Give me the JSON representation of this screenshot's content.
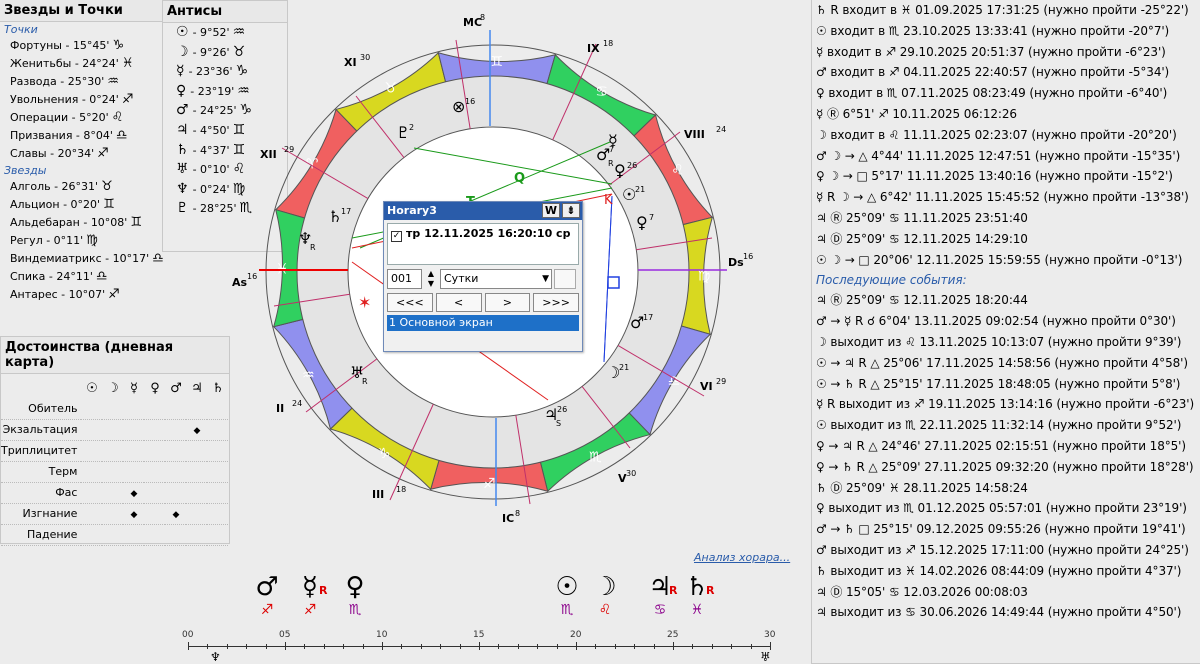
{
  "stars_panel": {
    "title": "Звезды и Точки",
    "points_header": "Точки",
    "points": [
      {
        "label": "Фортуны - 15°45'",
        "glyph": "♑"
      },
      {
        "label": "Женитьбы - 24°24'",
        "glyph": "♓"
      },
      {
        "label": "Развода - 25°30'",
        "glyph": "♒"
      },
      {
        "label": "Увольнения - 0°24'",
        "glyph": "♐"
      },
      {
        "label": "Операции - 5°20'",
        "glyph": "♌"
      },
      {
        "label": "Призвания - 8°04'",
        "glyph": "♎"
      },
      {
        "label": "Славы - 20°34'",
        "glyph": "♐"
      }
    ],
    "stars_header": "Звезды",
    "stars": [
      {
        "label": "Алголь - 26°31'",
        "glyph": "♉"
      },
      {
        "label": "Альцион - 0°20'",
        "glyph": "♊"
      },
      {
        "label": "Альдебаран - 10°08'",
        "glyph": "♊"
      },
      {
        "label": "Регул - 0°11'",
        "glyph": "♍"
      },
      {
        "label": "Виндемиатрикс - 10°17'",
        "glyph": "♎"
      },
      {
        "label": "Спика - 24°11'",
        "glyph": "♎"
      },
      {
        "label": "Антарес - 10°07'",
        "glyph": "♐"
      }
    ]
  },
  "antis_panel": {
    "title": "Антисы",
    "rows": [
      {
        "planet": "☉",
        "label": "- 9°52'",
        "sign": "♒"
      },
      {
        "planet": "☽",
        "label": "- 9°26'",
        "sign": "♉"
      },
      {
        "planet": "☿",
        "label": "- 23°36'",
        "sign": "♑"
      },
      {
        "planet": "♀",
        "label": "- 23°19'",
        "sign": "♒"
      },
      {
        "planet": "♂",
        "label": "- 24°25'",
        "sign": "♑"
      },
      {
        "planet": "♃",
        "label": "- 4°50'",
        "sign": "♊"
      },
      {
        "planet": "♄",
        "label": "- 4°37'",
        "sign": "♊"
      },
      {
        "planet": "♅",
        "label": "- 0°10'",
        "sign": "♌"
      },
      {
        "planet": "♆",
        "label": "- 0°24'",
        "sign": "♍"
      },
      {
        "planet": "♇",
        "label": "- 28°25'",
        "sign": "♏"
      }
    ]
  },
  "dignities": {
    "title": "Достоинства (дневная карта)",
    "planets": [
      "☉",
      "☽",
      "☿",
      "♀",
      "♂",
      "♃",
      "♄"
    ],
    "rows": [
      {
        "label": "Обитель",
        "marks": [
          0,
          0,
          0,
          0,
          0,
          0,
          0
        ]
      },
      {
        "label": "Экзальтация",
        "marks": [
          0,
          0,
          0,
          0,
          0,
          1,
          0
        ]
      },
      {
        "label": "Триплицитет",
        "marks": [
          0,
          0,
          0,
          0,
          0,
          0,
          0
        ]
      },
      {
        "label": "Терм",
        "marks": [
          0,
          0,
          0,
          0,
          0,
          0,
          0
        ]
      },
      {
        "label": "Фас",
        "marks": [
          0,
          0,
          1,
          0,
          0,
          0,
          0
        ]
      },
      {
        "label": "Изгнание",
        "marks": [
          0,
          0,
          1,
          0,
          1,
          0,
          0
        ]
      },
      {
        "label": "Падение",
        "marks": [
          0,
          0,
          0,
          0,
          0,
          0,
          0
        ]
      }
    ],
    "mark_symbol": "◆"
  },
  "events": {
    "list": [
      "♄ R входит в ♓ 01.09.2025 17:31:25 (нужно пройти -25°22')",
      "☉ входит в ♏ 23.10.2025 13:33:41 (нужно пройти -20°7')",
      "☿ входит в ♐ 29.10.2025 20:51:37 (нужно пройти -6°23')",
      "♂ входит в ♐ 04.11.2025 22:40:57 (нужно пройти -5°34')",
      "♀ входит в ♏ 07.11.2025 08:23:49 (нужно пройти -6°40')",
      "☿ Ⓡ 6°51' ♐ 10.11.2025 06:12:26",
      "☽ входит в ♌ 11.11.2025 02:23:07 (нужно пройти -20°20')",
      "♂ ☽ → △ 4°44' 11.11.2025 12:47:51 (нужно пройти -15°35')",
      "♀ ☽ → □ 5°17' 11.11.2025 13:40:16 (нужно пройти -15°2')",
      "☿ R ☽ → △ 6°42' 11.11.2025 15:45:52 (нужно пройти -13°38')",
      "♃ Ⓡ 25°09' ♋ 11.11.2025 23:51:40",
      "♃ Ⓓ 25°09' ♋ 12.11.2025 14:29:10",
      "☉ ☽ → □ 20°06' 12.11.2025 15:59:55 (нужно пройти -0°13')"
    ],
    "next_header": "Последующие события:",
    "next": [
      "♃ Ⓡ 25°09' ♋ 12.11.2025 18:20:44",
      "♂ → ☿ R ☌ 6°04' 13.11.2025 09:02:54 (нужно пройти 0°30')",
      "☽ выходит из ♌ 13.11.2025 10:13:07 (нужно пройти 9°39')",
      "☉ → ♃ R △ 25°06' 17.11.2025 14:58:56 (нужно пройти 4°58')",
      "☉ → ♄ R △ 25°15' 17.11.2025 18:48:05 (нужно пройти 5°8')",
      "☿ R выходит из ♐ 19.11.2025 13:14:16 (нужно пройти -6°23')",
      "☉ выходит из ♏ 22.11.2025 11:32:14 (нужно пройти 9°52')",
      "♀ → ♃ R △ 24°46' 27.11.2025 02:15:51 (нужно пройти 18°5')",
      "♀ → ♄ R △ 25°09' 27.11.2025 09:32:20 (нужно пройти 18°28')",
      "♄ Ⓓ 25°09' ♓ 28.11.2025 14:58:24",
      "♀ выходит из ♏ 01.12.2025 05:57:01 (нужно пройти 23°19')",
      "♂ → ♄ □ 25°15' 09.12.2025 09:55:26 (нужно пройти 19°41')",
      "♂ выходит из ♐ 15.12.2025 17:11:00 (нужно пройти 24°25')",
      "♄ выходит из ♓ 14.02.2026 08:44:09 (нужно пройти 4°37')",
      "♃ Ⓓ 15°05' ♋ 12.03.2026 00:08:03",
      "♃ выходит из ♋ 30.06.2026 14:49:44 (нужно пройти 4°50')"
    ]
  },
  "chart": {
    "angles": {
      "mc": "MC",
      "mc_deg": "8",
      "ic": "IC",
      "ic_deg": "8",
      "as": "As",
      "as_deg": "16",
      "ds": "Ds",
      "ds_deg": "16"
    },
    "houses": [
      {
        "num": "IX",
        "deg": "18"
      },
      {
        "num": "VIII",
        "deg": "24"
      },
      {
        "num": "VI",
        "deg": "29"
      },
      {
        "num": "V",
        "deg": "30"
      },
      {
        "num": "III",
        "deg": "18"
      },
      {
        "num": "II",
        "deg": "24"
      },
      {
        "num": "XII",
        "deg": "29"
      },
      {
        "num": "XI",
        "deg": "30"
      }
    ],
    "signs": [
      "♈",
      "♉",
      "♊",
      "♋",
      "♌",
      "♍",
      "♎",
      "♏",
      "♐",
      "♑",
      "♒",
      "♓"
    ],
    "sign_colors": [
      "#f06060",
      "#d8d820",
      "#9090ee",
      "#30d060",
      "#f06060",
      "#d8d820",
      "#9090ee",
      "#30d060",
      "#f06060",
      "#d8d820",
      "#9090ee",
      "#30d060"
    ],
    "planets": [
      {
        "glyph": "♂",
        "deg": "7",
        "note": "R"
      },
      {
        "glyph": "☿",
        "deg": "",
        "note": ""
      },
      {
        "glyph": "♀",
        "deg": "26",
        "note": ""
      },
      {
        "glyph": "☉",
        "deg": "21",
        "note": ""
      },
      {
        "glyph": "♀",
        "deg": "7",
        "note": ""
      },
      {
        "glyph": "♂",
        "deg": "17",
        "note": ""
      },
      {
        "glyph": "☽",
        "deg": "21",
        "note": ""
      },
      {
        "glyph": "♃",
        "deg": "26",
        "note": "S"
      },
      {
        "glyph": "♅",
        "deg": "",
        "note": "R"
      },
      {
        "glyph": "♆",
        "deg": "",
        "note": "R"
      },
      {
        "glyph": "♄",
        "deg": "17",
        "note": ""
      },
      {
        "glyph": "♇",
        "deg": "2",
        "note": ""
      },
      {
        "glyph": "⊗",
        "deg": "16",
        "note": ""
      }
    ],
    "aspect_labels": [
      "Q",
      "T"
    ]
  },
  "dialog": {
    "title": "Horary3",
    "w_btn": "W",
    "datetime": "тр 12.11.2025 16:20:10 ср",
    "checkbox": "✓",
    "step": "001",
    "unit": "Сутки",
    "nav": [
      "<<<",
      "<",
      ">",
      ">>>"
    ],
    "screen": "1 Основной экран"
  },
  "link": "Анализ хорара...",
  "bottom_planets": [
    {
      "glyph": "♂",
      "sign": "♐",
      "r": ""
    },
    {
      "glyph": "☿",
      "sign": "♐",
      "r": "R"
    },
    {
      "glyph": "♀",
      "sign": "♏",
      "r": ""
    },
    {
      "glyph": "☉",
      "sign": "♏",
      "r": ""
    },
    {
      "glyph": "☽",
      "sign": "♌",
      "r": ""
    },
    {
      "glyph": "♃",
      "sign": "♋",
      "r": "R"
    },
    {
      "glyph": "♄",
      "sign": "♓",
      "r": "R"
    }
  ],
  "scale": {
    "ticks": [
      "00",
      "05",
      "10",
      "15",
      "20",
      "25",
      "30"
    ],
    "left_glyph": "♆",
    "right_glyph": "♅"
  },
  "colors": {
    "accent": "#2a5caa",
    "retro": "#d00000",
    "sign_text": "#8b008b"
  }
}
